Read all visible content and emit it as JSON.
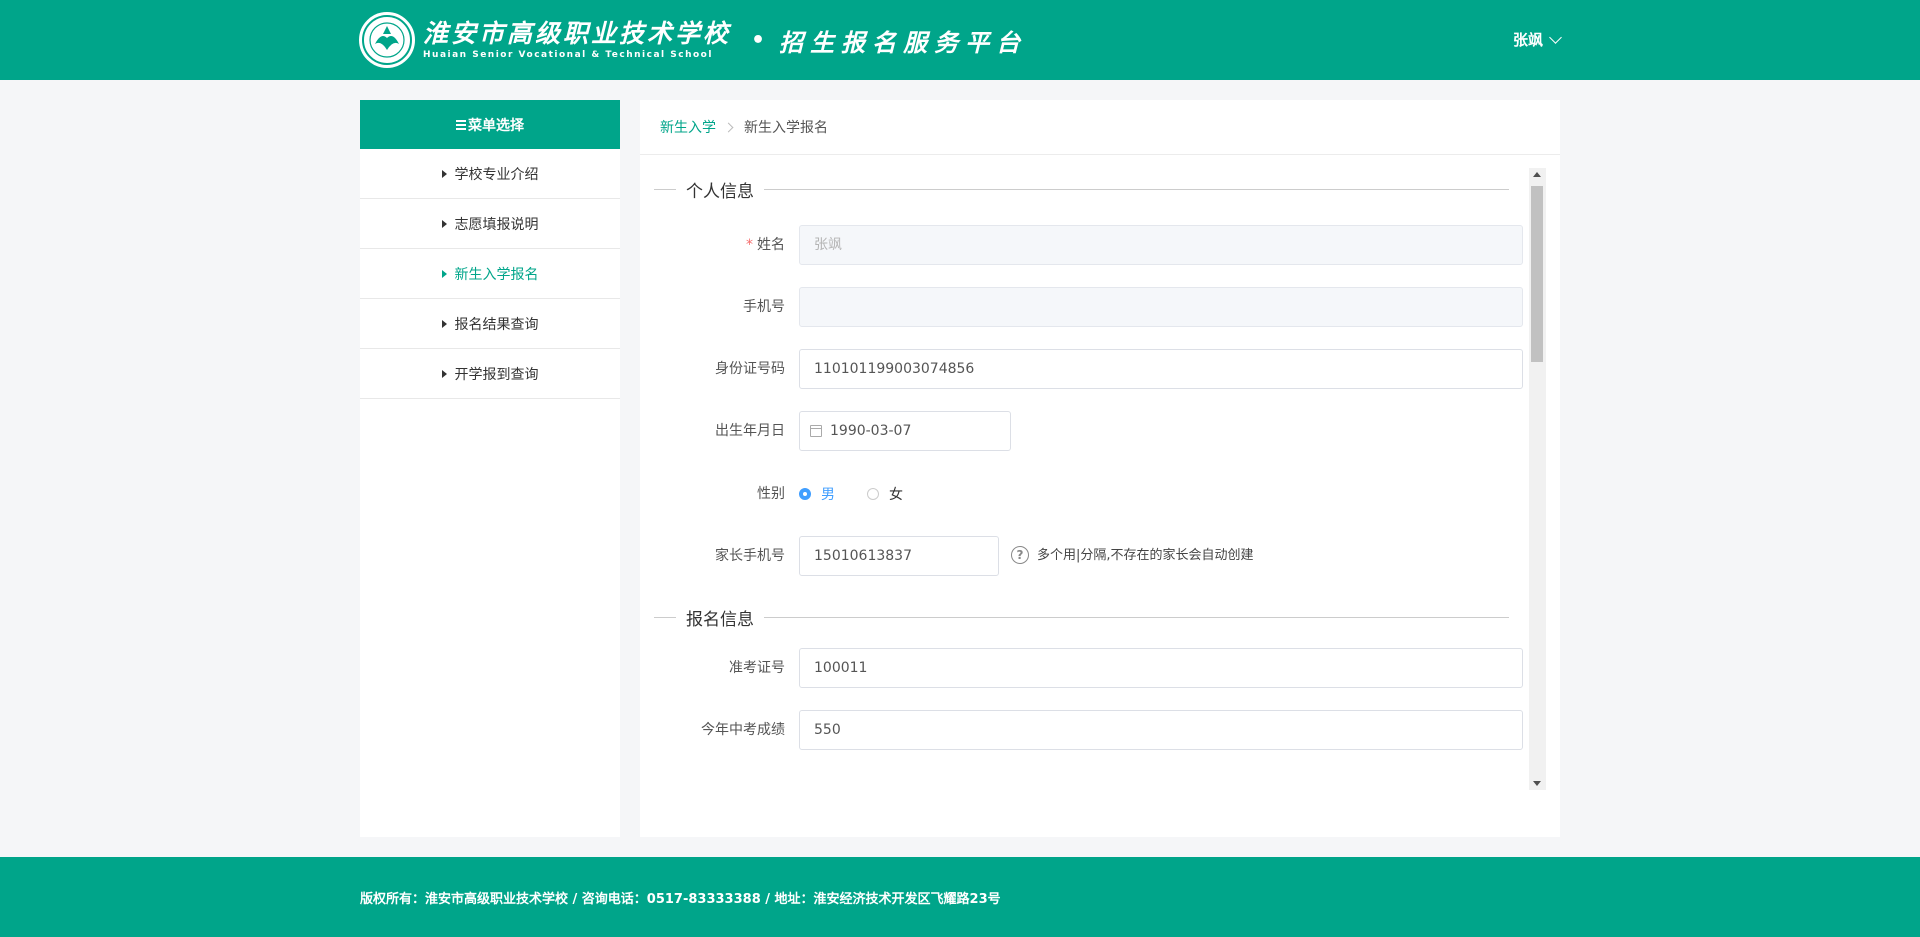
{
  "header": {
    "school_name_cn": "淮安市高级职业技术学校",
    "school_name_en": "Huaian Senior Vocational & Technical School",
    "separator": "•",
    "platform_title": "招生报名服务平台",
    "user_name": "张飒"
  },
  "colors": {
    "brand": "#00a58a",
    "radio_active": "#409eff",
    "required": "#f56c6c"
  },
  "sidebar": {
    "title": "菜单选择",
    "items": [
      {
        "label": "学校专业介绍",
        "active": false
      },
      {
        "label": "志愿填报说明",
        "active": false
      },
      {
        "label": "新生入学报名",
        "active": true
      },
      {
        "label": "报名结果查询",
        "active": false
      },
      {
        "label": "开学报到查询",
        "active": false
      }
    ]
  },
  "breadcrumb": {
    "parent": "新生入学",
    "current": "新生入学报名"
  },
  "form": {
    "section_personal": "个人信息",
    "section_registration": "报名信息",
    "name_label": "姓名",
    "name_required_mark": "*",
    "name_value": "张飒",
    "phone_label": "手机号",
    "phone_value": "",
    "id_label": "身份证号码",
    "id_value": "110101199003074856",
    "birth_label": "出生年月日",
    "birth_value": "1990-03-07",
    "gender_label": "性别",
    "gender_male": "男",
    "gender_female": "女",
    "gender_selected": "男",
    "parent_phone_label": "家长手机号",
    "parent_phone_value": "15010613837",
    "parent_phone_help_icon": "?",
    "parent_phone_help": "多个用|分隔,不存在的家长会自动创建",
    "exam_no_label": "准考证号",
    "exam_no_value": "100011",
    "score_label": "今年中考成绩",
    "score_value": "550"
  },
  "footer": {
    "text": "版权所有：淮安市高级职业技术学校 / 咨询电话：0517-83333388 / 地址：淮安经济技术开发区飞耀路23号"
  }
}
